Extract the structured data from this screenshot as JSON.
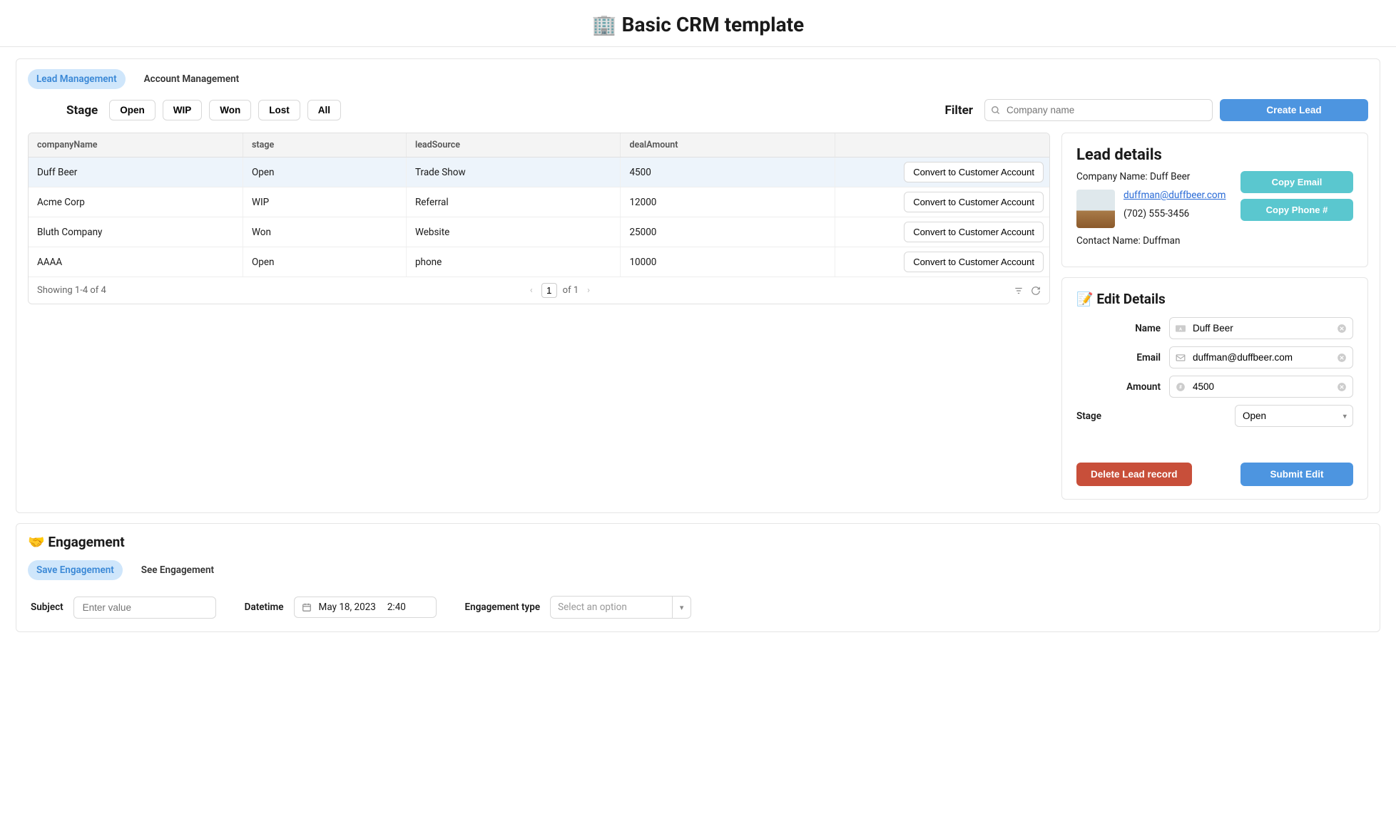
{
  "page_title": "🏢 Basic CRM template",
  "tabs": {
    "lead": "Lead Management",
    "account": "Account Management"
  },
  "stage": {
    "label": "Stage",
    "buttons": [
      "Open",
      "WIP",
      "Won",
      "Lost",
      "All"
    ]
  },
  "filter": {
    "label": "Filter",
    "placeholder": "Company name"
  },
  "create_lead_btn": "Create Lead",
  "table": {
    "headers": [
      "companyName",
      "stage",
      "leadSource",
      "dealAmount"
    ],
    "rows": [
      {
        "companyName": "Duff Beer",
        "stage": "Open",
        "leadSource": "Trade Show",
        "dealAmount": "4500",
        "selected": true
      },
      {
        "companyName": "Acme Corp",
        "stage": "WIP",
        "leadSource": "Referral",
        "dealAmount": "12000",
        "selected": false
      },
      {
        "companyName": "Bluth Company",
        "stage": "Won",
        "leadSource": "Website",
        "dealAmount": "25000",
        "selected": false
      },
      {
        "companyName": "AAAA",
        "stage": "Open",
        "leadSource": "phone",
        "dealAmount": "10000",
        "selected": false
      }
    ],
    "row_action": "Convert to Customer Account",
    "footer_showing": "Showing 1-4 of 4",
    "page_input": "1",
    "of_label": "of 1"
  },
  "lead_details": {
    "title": "Lead details",
    "company_label": "Company Name: Duff Beer",
    "email": "duffman@duffbeer.com",
    "phone": "(702) 555-3456",
    "contact_label": "Contact Name: Duffman",
    "copy_email": "Copy Email",
    "copy_phone": "Copy Phone #"
  },
  "edit": {
    "title": "📝 Edit Details",
    "name_label": "Name",
    "name_value": "Duff Beer",
    "email_label": "Email",
    "email_value": "duffman@duffbeer.com",
    "amount_label": "Amount",
    "amount_value": "4500",
    "stage_label": "Stage",
    "stage_value": "Open",
    "delete_btn": "Delete Lead record",
    "submit_btn": "Submit Edit"
  },
  "engagement": {
    "title": "🤝 Engagement",
    "tab_save": "Save Engagement",
    "tab_see": "See Engagement",
    "subject_label": "Subject",
    "subject_placeholder": "Enter value",
    "datetime_label": "Datetime",
    "date_value": "May 18, 2023",
    "time_value": "2:40",
    "type_label": "Engagement type",
    "type_placeholder": "Select an option"
  }
}
